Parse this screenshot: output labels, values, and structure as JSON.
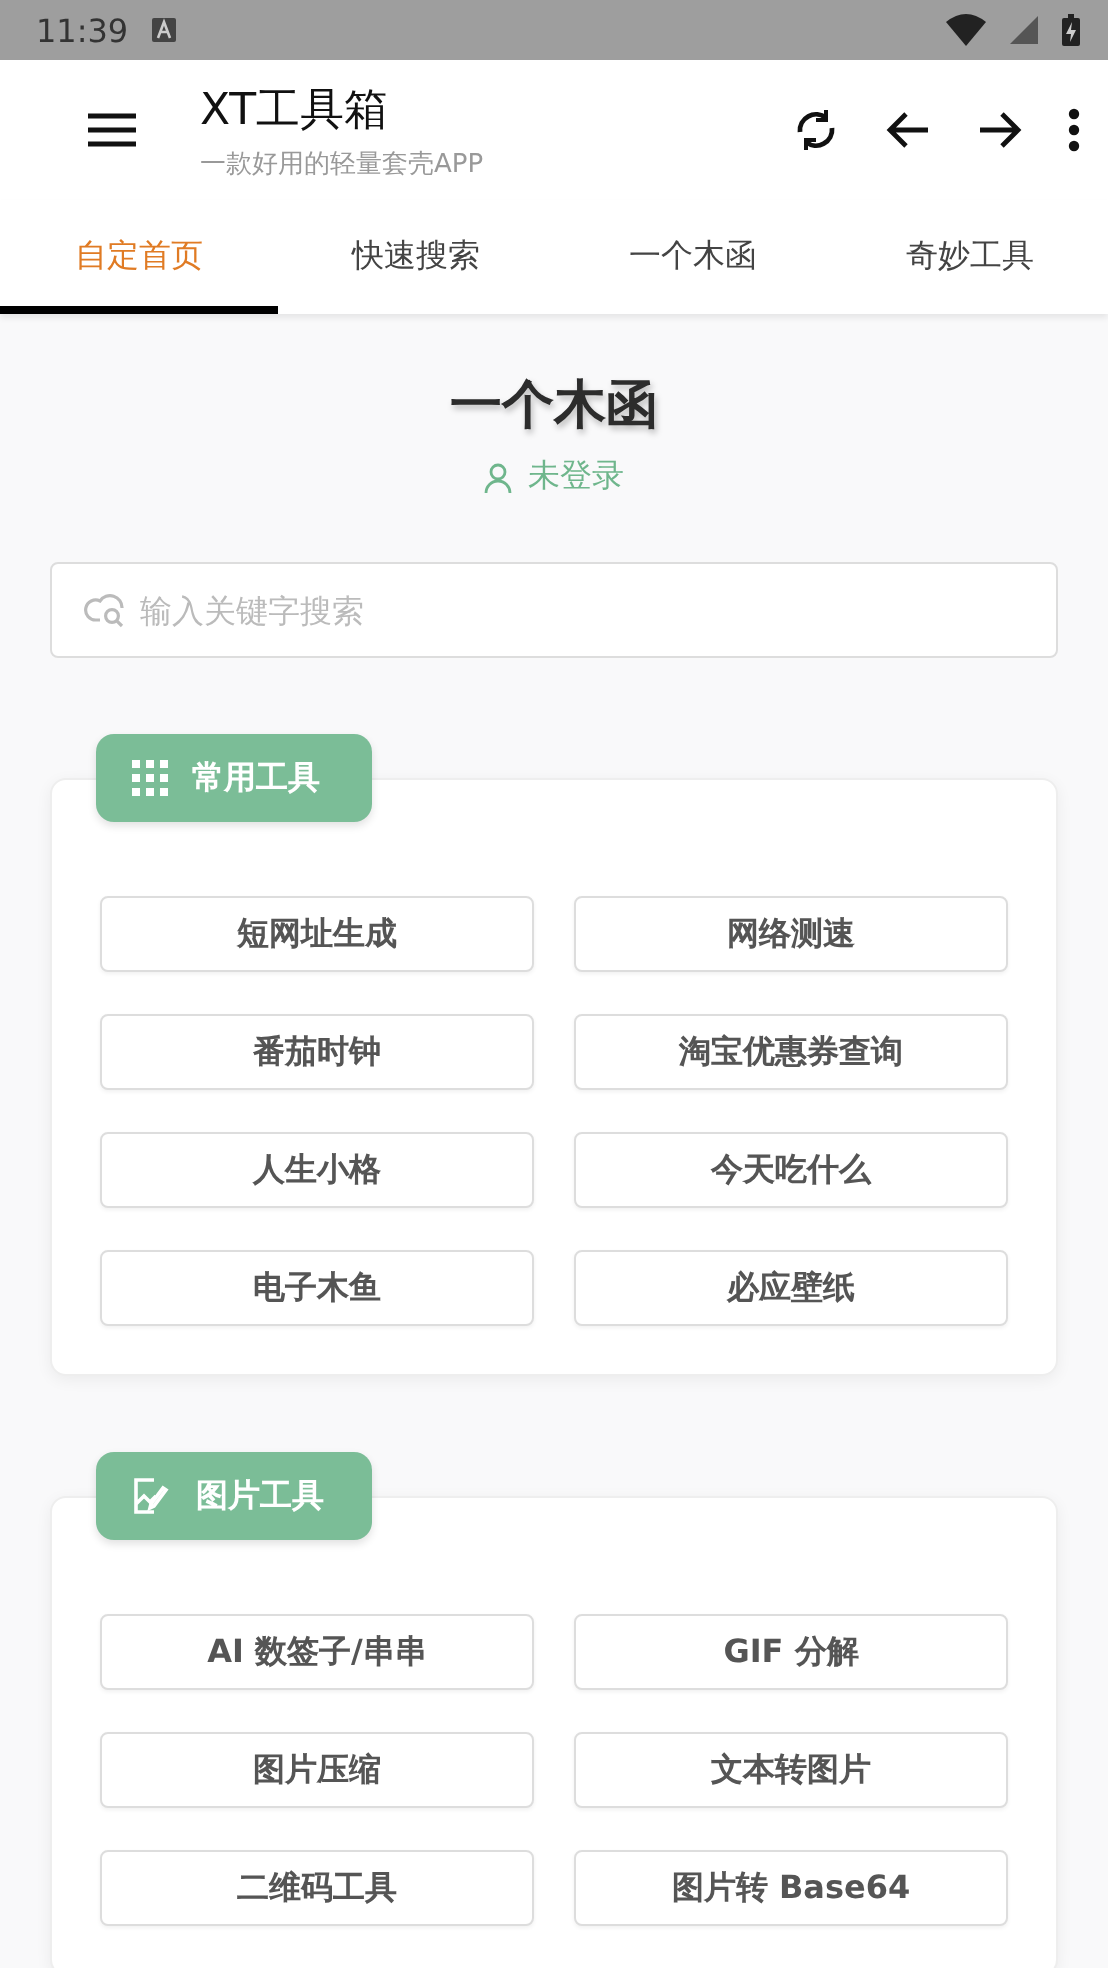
{
  "status_bar": {
    "time": "11:39"
  },
  "app_bar": {
    "title": "XT工具箱",
    "subtitle": "一款好用的轻量套壳APP"
  },
  "tabs": [
    {
      "label": "自定首页",
      "selected": true
    },
    {
      "label": "快速搜索",
      "selected": false
    },
    {
      "label": "一个木函",
      "selected": false
    },
    {
      "label": "奇妙工具",
      "selected": false
    }
  ],
  "header": {
    "title": "一个木函",
    "login": "未登录"
  },
  "search": {
    "placeholder": "输入关键字搜索"
  },
  "sections": [
    {
      "kind": "grid",
      "title": "常用工具",
      "tools": [
        "短网址生成",
        "网络测速",
        "番茄时钟",
        "淘宝优惠券查询",
        "人生小格",
        "今天吃什么",
        "电子木鱼",
        "必应壁纸"
      ]
    },
    {
      "kind": "image",
      "title": "图片工具",
      "tools": [
        "AI 数签子/串串",
        "GIF 分解",
        "图片压缩",
        "文本转图片",
        "二维码工具",
        "图片转 Base64"
      ]
    }
  ]
}
